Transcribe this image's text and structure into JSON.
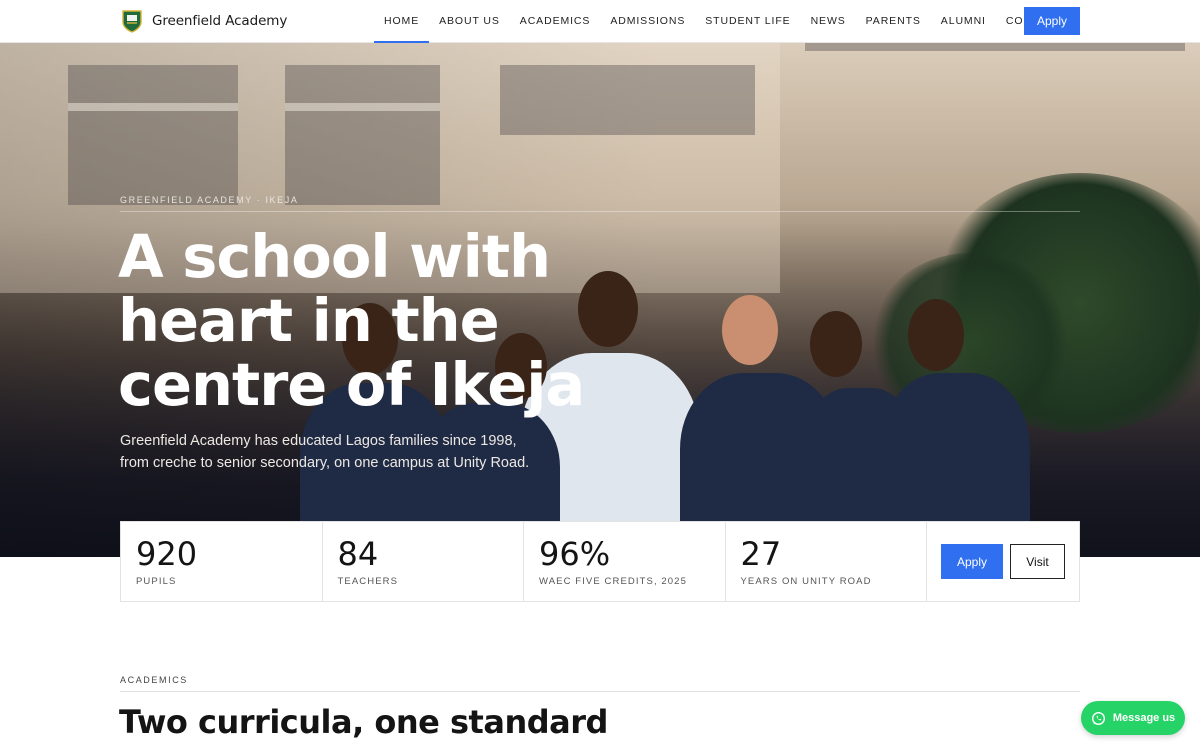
{
  "header": {
    "brand_name": "Greenfield Academy",
    "nav": [
      {
        "label": "HOME",
        "active": true
      },
      {
        "label": "ABOUT US"
      },
      {
        "label": "ACADEMICS"
      },
      {
        "label": "ADMISSIONS"
      },
      {
        "label": "STUDENT LIFE"
      },
      {
        "label": "NEWS"
      },
      {
        "label": "PARENTS"
      },
      {
        "label": "ALUMNI"
      },
      {
        "label": "CONTACT"
      }
    ],
    "apply_label": "Apply",
    "accent_color": "#2f6ff0"
  },
  "hero": {
    "eyebrow": "GREENFIELD ACADEMY · IKEJA",
    "title": "A school with heart in the centre of Ikeja",
    "subtitle": "Greenfield Academy has educated Lagos families since 1998, from creche to senior secondary, on one campus at Unity Road."
  },
  "stats": [
    {
      "value": "920",
      "label": "PUPILS"
    },
    {
      "value": "84",
      "label": "TEACHERS"
    },
    {
      "value": "96%",
      "label": "WAEC FIVE CREDITS, 2025"
    },
    {
      "value": "27",
      "label": "YEARS ON UNITY ROAD"
    }
  ],
  "stats_actions": {
    "apply_label": "Apply",
    "visit_label": "Visit"
  },
  "academics": {
    "eyebrow": "ACADEMICS",
    "title": "Two curricula, one standard"
  },
  "whatsapp": {
    "label": "Message us",
    "color": "#25d366",
    "icon": "whatsapp-icon"
  }
}
